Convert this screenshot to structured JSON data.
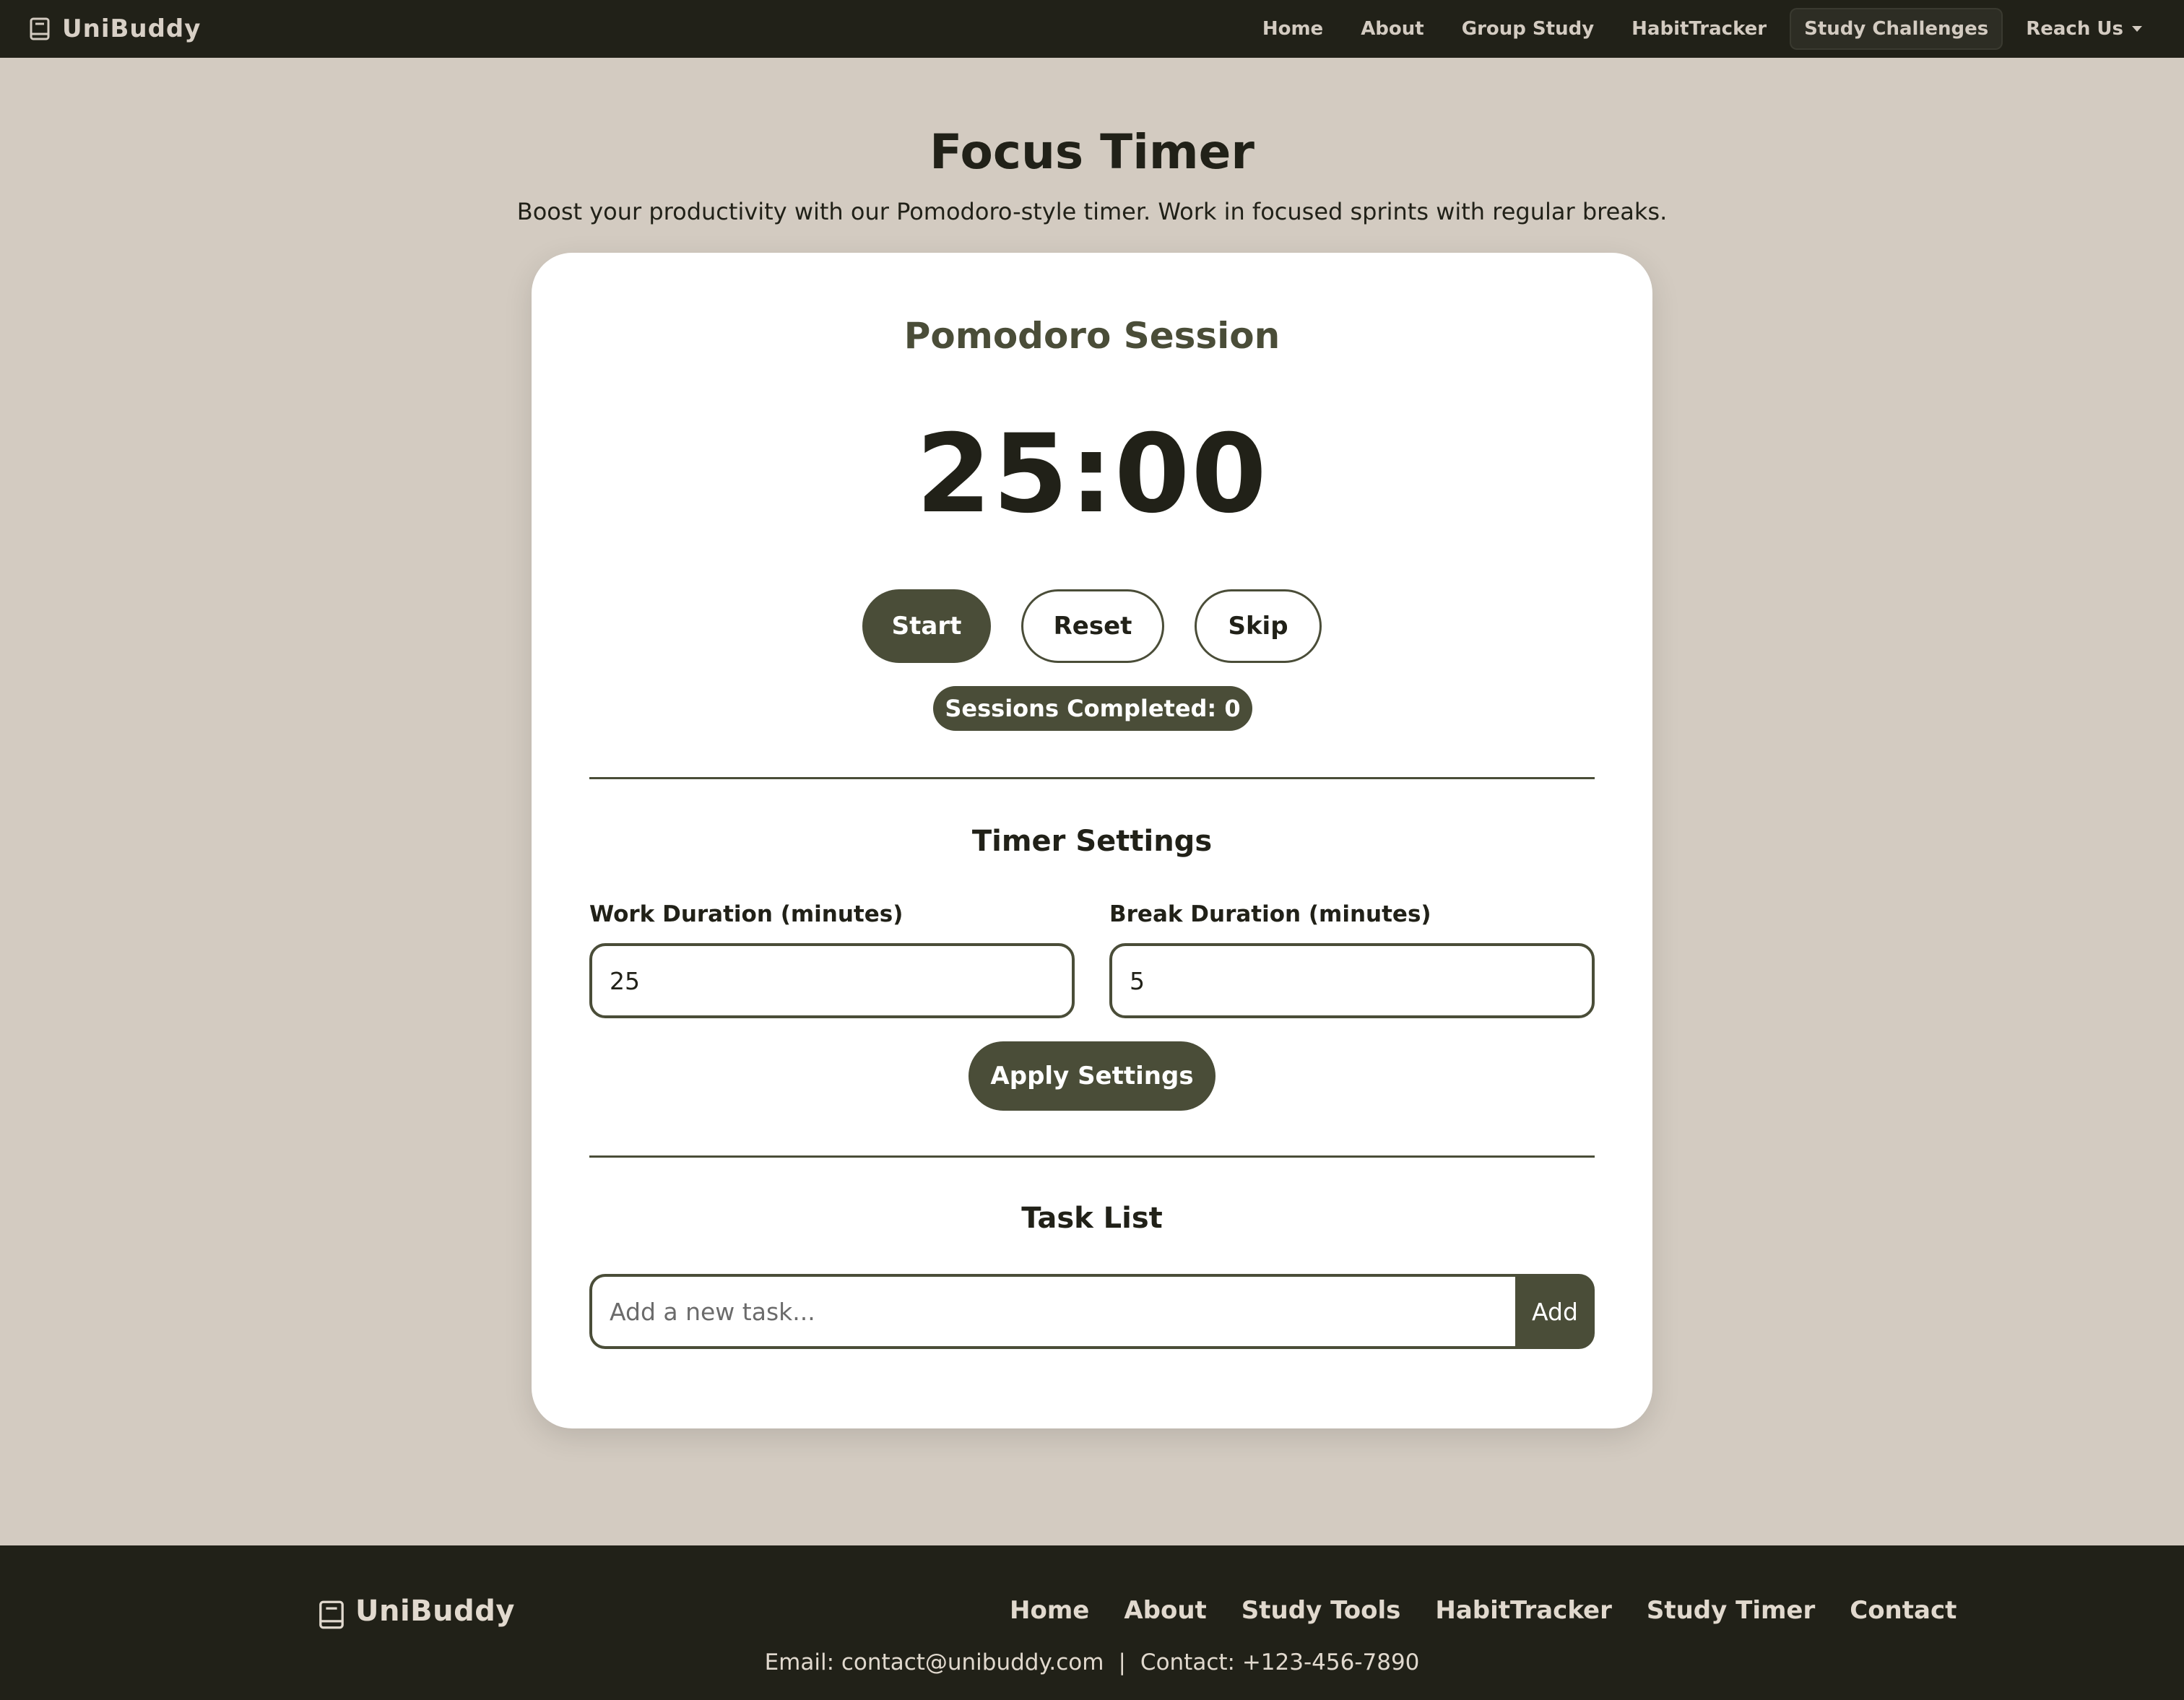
{
  "nav": {
    "brand": "UniBuddy",
    "brand_icon": "book-icon",
    "links": [
      "Home",
      "About",
      "Group Study",
      "HabitTracker",
      "Study Challenges"
    ],
    "active_link": "Study Challenges",
    "dropdown_label": "Reach Us"
  },
  "header": {
    "title": "Focus Timer",
    "subtitle": "Boost your productivity with our Pomodoro-style timer. Work in focused sprints with regular breaks."
  },
  "timer": {
    "session_title": "Pomodoro Session",
    "display": "25:00",
    "start_label": "Start",
    "reset_label": "Reset",
    "skip_label": "Skip",
    "sessions_completed": "Sessions Completed: 0"
  },
  "settings": {
    "title": "Timer Settings",
    "work_label": "Work Duration (minutes)",
    "work_value": "25",
    "break_label": "Break Duration (minutes)",
    "break_value": "5",
    "apply_label": "Apply Settings"
  },
  "tasks": {
    "title": "Task List",
    "placeholder": "Add a new task...",
    "add_label": "Add"
  },
  "footer": {
    "brand": "UniBuddy",
    "links": [
      "Home",
      "About",
      "Study Tools",
      "HabitTracker",
      "Study Timer",
      "Contact"
    ],
    "email": "Email: contact@unibuddy.com",
    "separator": "|",
    "phone": "Contact: +123-456-7890"
  },
  "colors": {
    "background": "#d3cbc1",
    "dark": "#212118",
    "accent": "#4a4d38",
    "card": "#ffffff"
  }
}
